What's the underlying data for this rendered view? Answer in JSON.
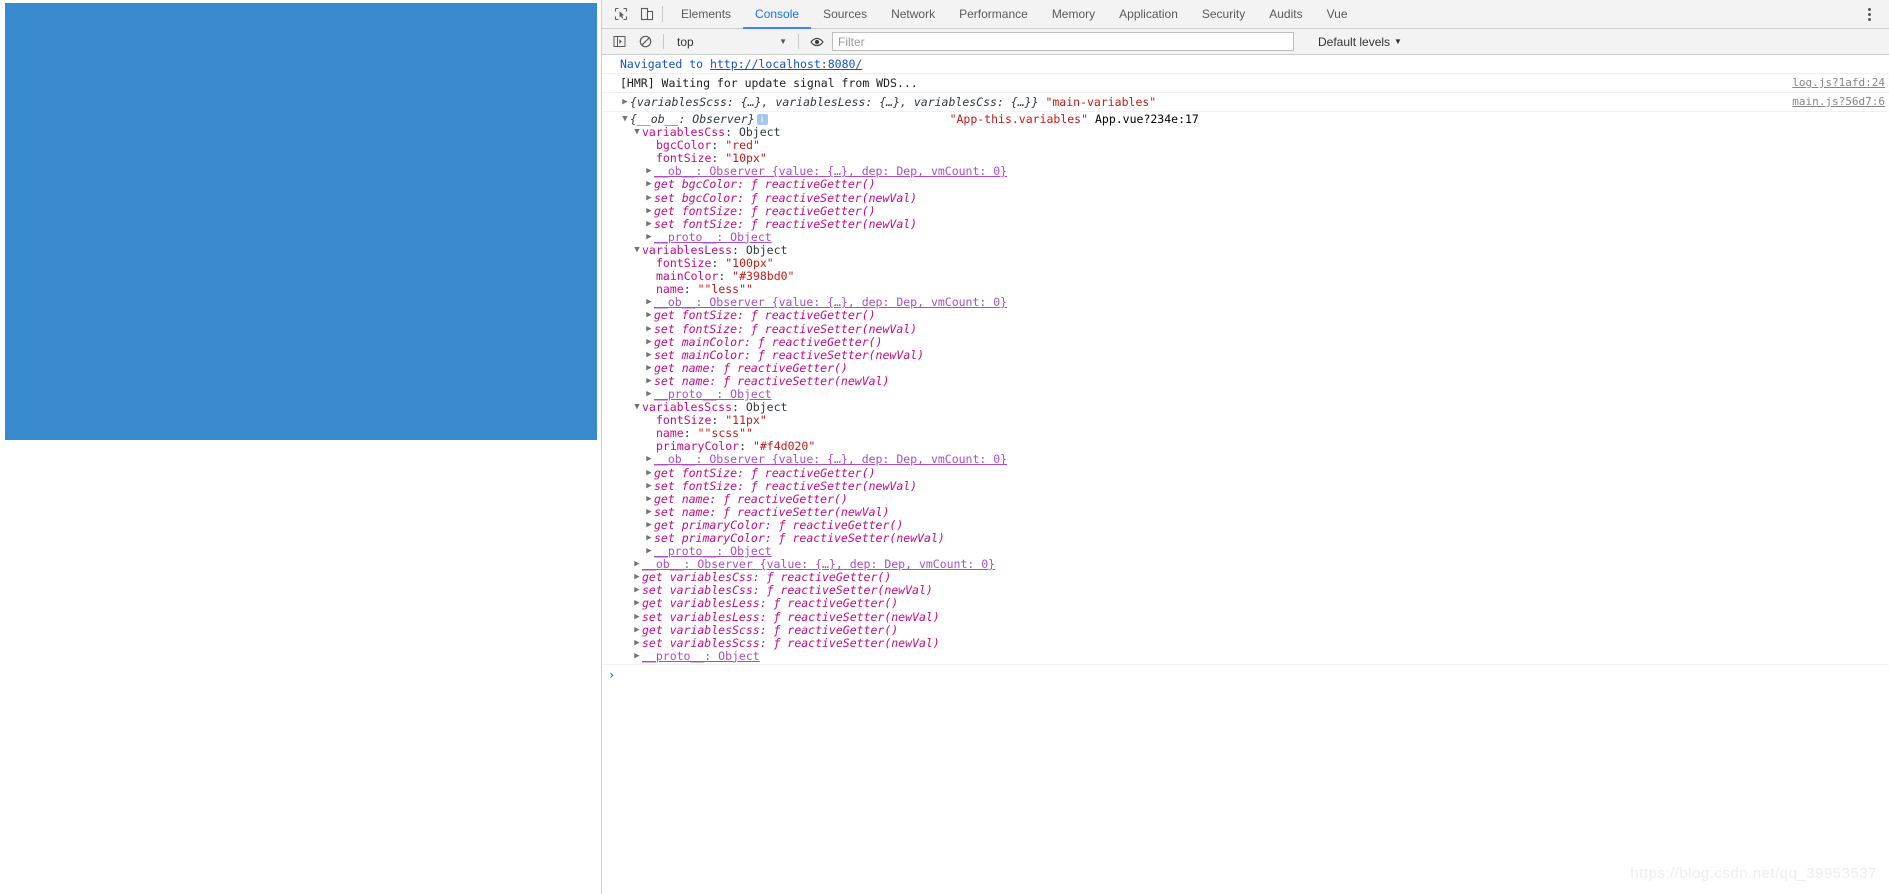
{
  "page": {
    "blue_panel_color": "#3a8ad0"
  },
  "devtools": {
    "toolbar_icons": [
      {
        "name": "inspect-element-icon",
        "glyph": "cursor"
      },
      {
        "name": "device-toolbar-icon",
        "glyph": "device"
      }
    ],
    "tabs": [
      {
        "label": "Elements",
        "active": false
      },
      {
        "label": "Console",
        "active": true
      },
      {
        "label": "Sources",
        "active": false
      },
      {
        "label": "Network",
        "active": false
      },
      {
        "label": "Performance",
        "active": false
      },
      {
        "label": "Memory",
        "active": false
      },
      {
        "label": "Application",
        "active": false
      },
      {
        "label": "Security",
        "active": false
      },
      {
        "label": "Audits",
        "active": false
      },
      {
        "label": "Vue",
        "active": false
      }
    ],
    "more_menu_label": "More options",
    "filterbar": {
      "sidebar_toggle": "show-console-sidebar-icon",
      "clear_label": "clear-console-icon",
      "context_value": "top",
      "eye_label": "live-expression-icon",
      "filter_placeholder": "Filter",
      "filter_value": "",
      "levels_label": "Default levels",
      "caret": "▼"
    }
  },
  "console": {
    "navigated": {
      "prefix": "Navigated to",
      "url": "http://localhost:8080/"
    },
    "hmr": {
      "text": "[HMR] Waiting for update signal from WDS...",
      "source": "log.js?1afd:24"
    },
    "main_variables": {
      "preview": "{variablesScss: {…}, variablesLess: {…}, variablesCss: {…}}",
      "label": "\"main-variables\"",
      "source": "main.js?56d7:6"
    },
    "app_variables": {
      "root_preview": "{__ob__: Observer}",
      "label": "\"App-this.variables\"",
      "source": "App.vue?234e:17",
      "groups": [
        {
          "name": "variablesCss",
          "type": "Object",
          "props": [
            {
              "key": "bgcColor",
              "value": "\"red\""
            },
            {
              "key": "fontSize",
              "value": "\"10px\""
            }
          ],
          "observer": "__ob__: Observer {value: {…}, dep: Dep, vmCount: 0}",
          "accessors": [
            "get bgcColor: ƒ reactiveGetter()",
            "set bgcColor: ƒ reactiveSetter(newVal)",
            "get fontSize: ƒ reactiveGetter()",
            "set fontSize: ƒ reactiveSetter(newVal)"
          ],
          "proto": "__proto__: Object"
        },
        {
          "name": "variablesLess",
          "type": "Object",
          "props": [
            {
              "key": "fontSize",
              "value": "\"100px\""
            },
            {
              "key": "mainColor",
              "value": "\"#398bd0\""
            },
            {
              "key": "name",
              "value": "\"\"less\"\""
            }
          ],
          "observer": "__ob__: Observer {value: {…}, dep: Dep, vmCount: 0}",
          "accessors": [
            "get fontSize: ƒ reactiveGetter()",
            "set fontSize: ƒ reactiveSetter(newVal)",
            "get mainColor: ƒ reactiveGetter()",
            "set mainColor: ƒ reactiveSetter(newVal)",
            "get name: ƒ reactiveGetter()",
            "set name: ƒ reactiveSetter(newVal)"
          ],
          "proto": "__proto__: Object"
        },
        {
          "name": "variablesScss",
          "type": "Object",
          "props": [
            {
              "key": "fontSize",
              "value": "\"11px\""
            },
            {
              "key": "name",
              "value": "\"\"scss\"\""
            },
            {
              "key": "primaryColor",
              "value": "\"#f4d020\""
            }
          ],
          "observer": "__ob__: Observer {value: {…}, dep: Dep, vmCount: 0}",
          "accessors": [
            "get fontSize: ƒ reactiveGetter()",
            "set fontSize: ƒ reactiveSetter(newVal)",
            "get name: ƒ reactiveGetter()",
            "set name: ƒ reactiveSetter(newVal)",
            "get primaryColor: ƒ reactiveGetter()",
            "set primaryColor: ƒ reactiveSetter(newVal)"
          ],
          "proto": "__proto__: Object"
        }
      ],
      "root_observer": "__ob__: Observer {value: {…}, dep: Dep, vmCount: 0}",
      "root_accessors": [
        "get variablesCss: ƒ reactiveGetter()",
        "set variablesCss: ƒ reactiveSetter(newVal)",
        "get variablesLess: ƒ reactiveGetter()",
        "set variablesLess: ƒ reactiveSetter(newVal)",
        "get variablesScss: ƒ reactiveGetter()",
        "set variablesScss: ƒ reactiveSetter(newVal)"
      ],
      "root_proto": "__proto__: Object"
    },
    "prompt_chevron": "›"
  },
  "watermark": "https://blog.csdn.net/qq_39953537"
}
